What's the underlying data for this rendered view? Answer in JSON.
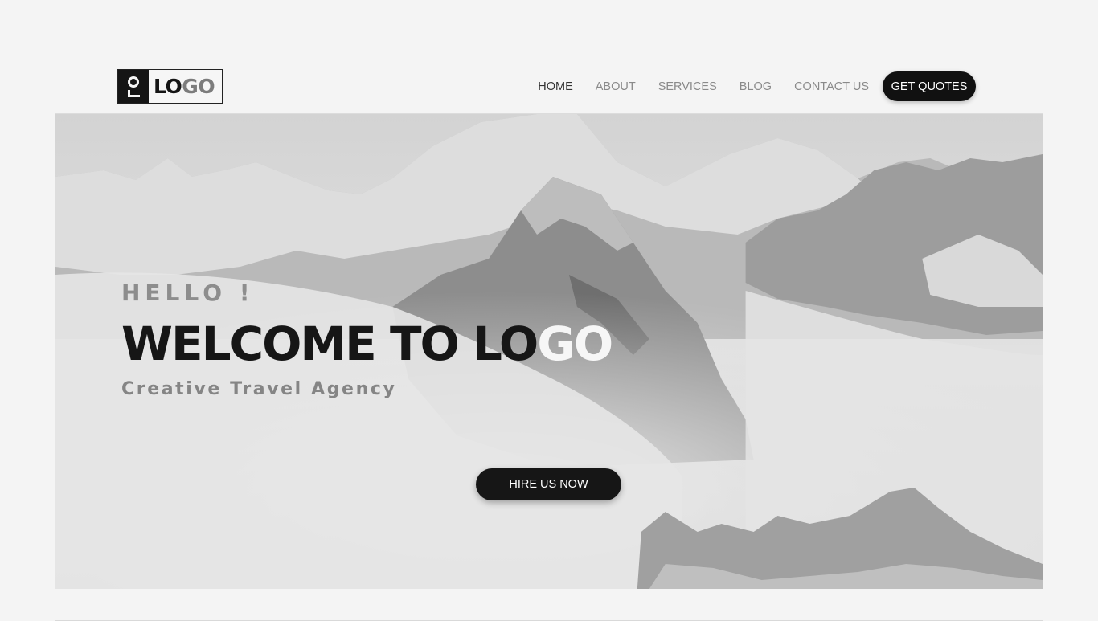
{
  "logo": {
    "part1": "LO",
    "part2": "GO"
  },
  "nav": {
    "items": [
      {
        "label": "HOME"
      },
      {
        "label": "ABOUT"
      },
      {
        "label": "SERVICES"
      },
      {
        "label": "BLOG"
      },
      {
        "label": "CONTACT US"
      }
    ],
    "cta_label": "GET QUOTES"
  },
  "hero": {
    "hello": "HELLO !",
    "title_part1": "WELCOME TO LO",
    "title_part2": "GO",
    "tagline": "Creative Travel Agency",
    "button_label": "HIRE US NOW"
  },
  "colors": {
    "accent": "#161616",
    "muted": "#8a8a8a",
    "background": "#f4f4f4"
  }
}
